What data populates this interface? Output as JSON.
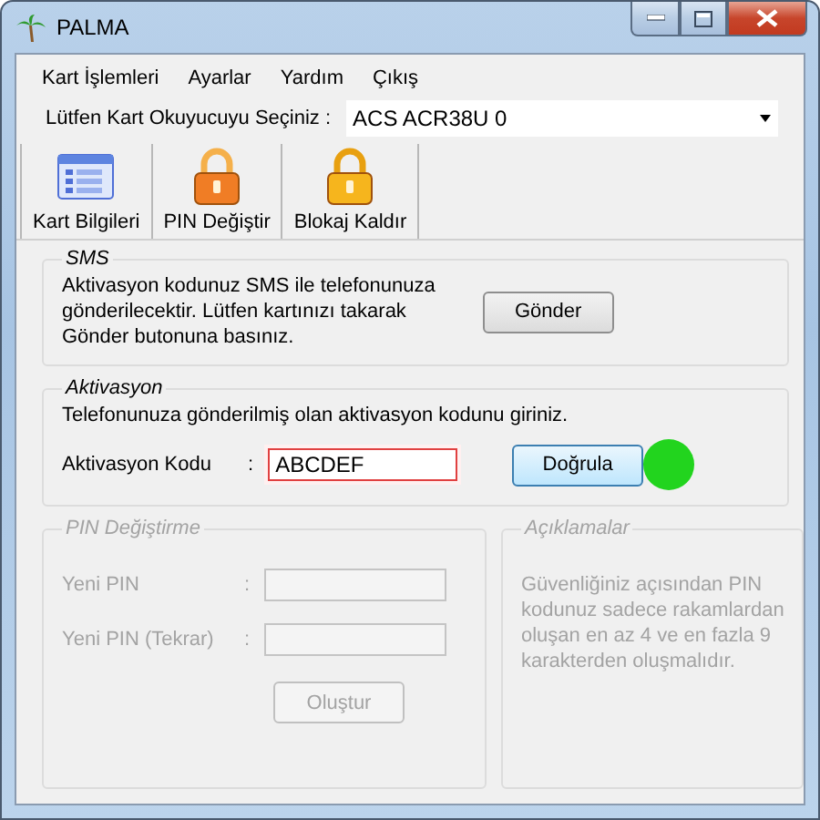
{
  "window": {
    "title": "PALMA"
  },
  "menu": [
    {
      "label": "Kart İşlemleri"
    },
    {
      "label": "Ayarlar"
    },
    {
      "label": "Yardım"
    },
    {
      "label": "Çıkış"
    }
  ],
  "reader": {
    "label": "Lütfen Kart Okuyucuyu Seçiniz :",
    "value": "ACS ACR38U 0"
  },
  "toolbar": [
    {
      "label": "Kart Bilgileri",
      "kind": "list"
    },
    {
      "label": "PIN Değiştir",
      "kind": "orange-lock"
    },
    {
      "label": "Blokaj Kaldır",
      "kind": "gold-lock"
    }
  ],
  "sms": {
    "title": "SMS",
    "lines": [
      "Aktivasyon kodunuz SMS ile telefonunuza",
      "gönderilecektir. Lütfen kartınızı takarak",
      "Gönder butonuna basınız."
    ],
    "button": "Gönder"
  },
  "activation": {
    "title": "Aktivasyon",
    "instruction": "Telefonunuza gönderilmiş olan aktivasyon kodunu giriniz.",
    "label": "Aktivasyon Kodu",
    "separator": ":",
    "value": "ABCDEF",
    "highlighted": true,
    "button": "Doğrula",
    "focused": true
  },
  "pin_change": {
    "title": "PIN Değiştirme",
    "disabled": true,
    "fields": [
      {
        "label": "Yeni PIN",
        "separator": ":"
      },
      {
        "label": "Yeni PIN (Tekrar)",
        "separator": ":"
      }
    ],
    "button": "Oluştur"
  },
  "notes": {
    "title": "Açıklamalar",
    "disabled": true,
    "lines": [
      "Güvenliğiniz açısından PIN",
      "kodunuz sadece rakamlardan",
      "oluşan en az 4 ve en fazla 9",
      "karakterden oluşmalıdır."
    ]
  }
}
